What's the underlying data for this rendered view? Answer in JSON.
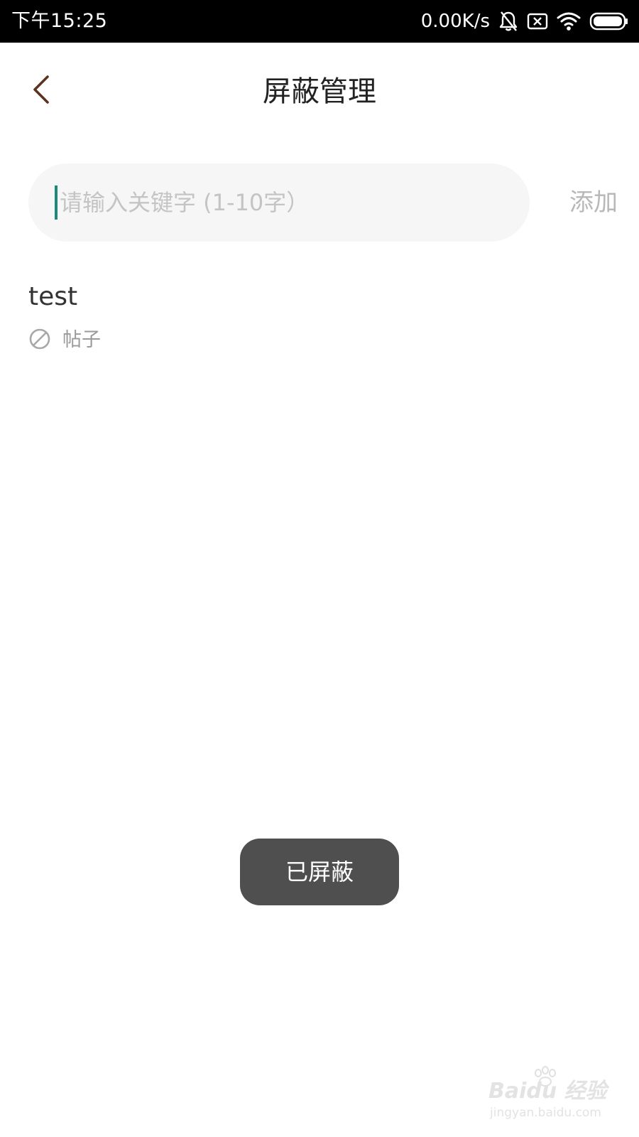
{
  "status_bar": {
    "time": "下午15:25",
    "net_speed": "0.00K/s",
    "icons": [
      "bell-off-icon",
      "sim-error-icon",
      "wifi-icon",
      "battery-icon"
    ]
  },
  "app_bar": {
    "back_icon": "chevron-left-icon",
    "title": "屏蔽管理"
  },
  "search": {
    "placeholder": "请输入关键字 (1-10字）",
    "value": "",
    "add_label": "添加"
  },
  "blocked_items": [
    {
      "keyword": "test",
      "scope_icon": "block-icon",
      "scope": "帖子"
    }
  ],
  "toast": {
    "message": "已屏蔽"
  },
  "watermark": {
    "brand": "Baidu 经验",
    "url": "jingyan.baidu.com"
  },
  "colors": {
    "status_bar_bg": "#000000",
    "back_icon": "#5a3420",
    "caret": "#1c8a78",
    "input_bg": "#f6f6f6",
    "toast_bg": "#4f4f4f"
  }
}
